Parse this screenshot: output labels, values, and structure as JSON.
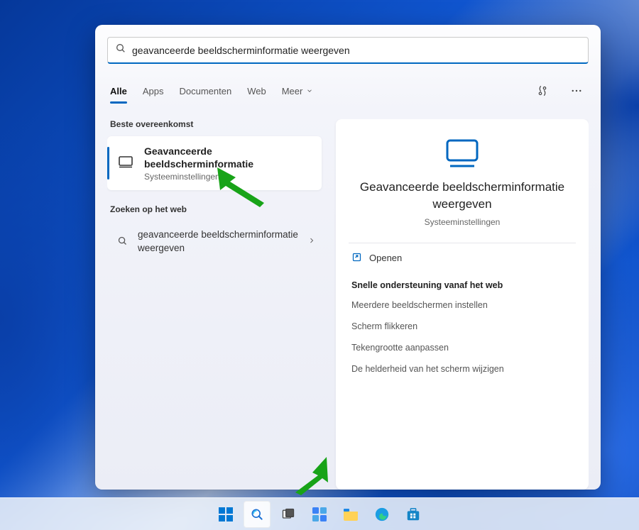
{
  "search": {
    "value": "geavanceerde beeldscherminformatie weergeven"
  },
  "tabs": {
    "all": "Alle",
    "apps": "Apps",
    "documents": "Documenten",
    "web": "Web",
    "more": "Meer"
  },
  "left": {
    "bestMatchLabel": "Beste overeenkomst",
    "result": {
      "title": "Geavanceerde beeldscherminformatie",
      "subtitle": "Systeeminstellingen"
    },
    "webLabel": "Zoeken op het web",
    "webItem": "geavanceerde beeldscherminformatie weergeven"
  },
  "preview": {
    "title": "Geavanceerde beeldscherminformatie weergeven",
    "subtitle": "Systeeminstellingen",
    "open": "Openen",
    "quickLabel": "Snelle ondersteuning vanaf het web",
    "links": {
      "l1": "Meerdere beeldschermen instellen",
      "l2": "Scherm flikkeren",
      "l3": "Tekengrootte aanpassen",
      "l4": "De helderheid van het scherm wijzigen"
    }
  }
}
